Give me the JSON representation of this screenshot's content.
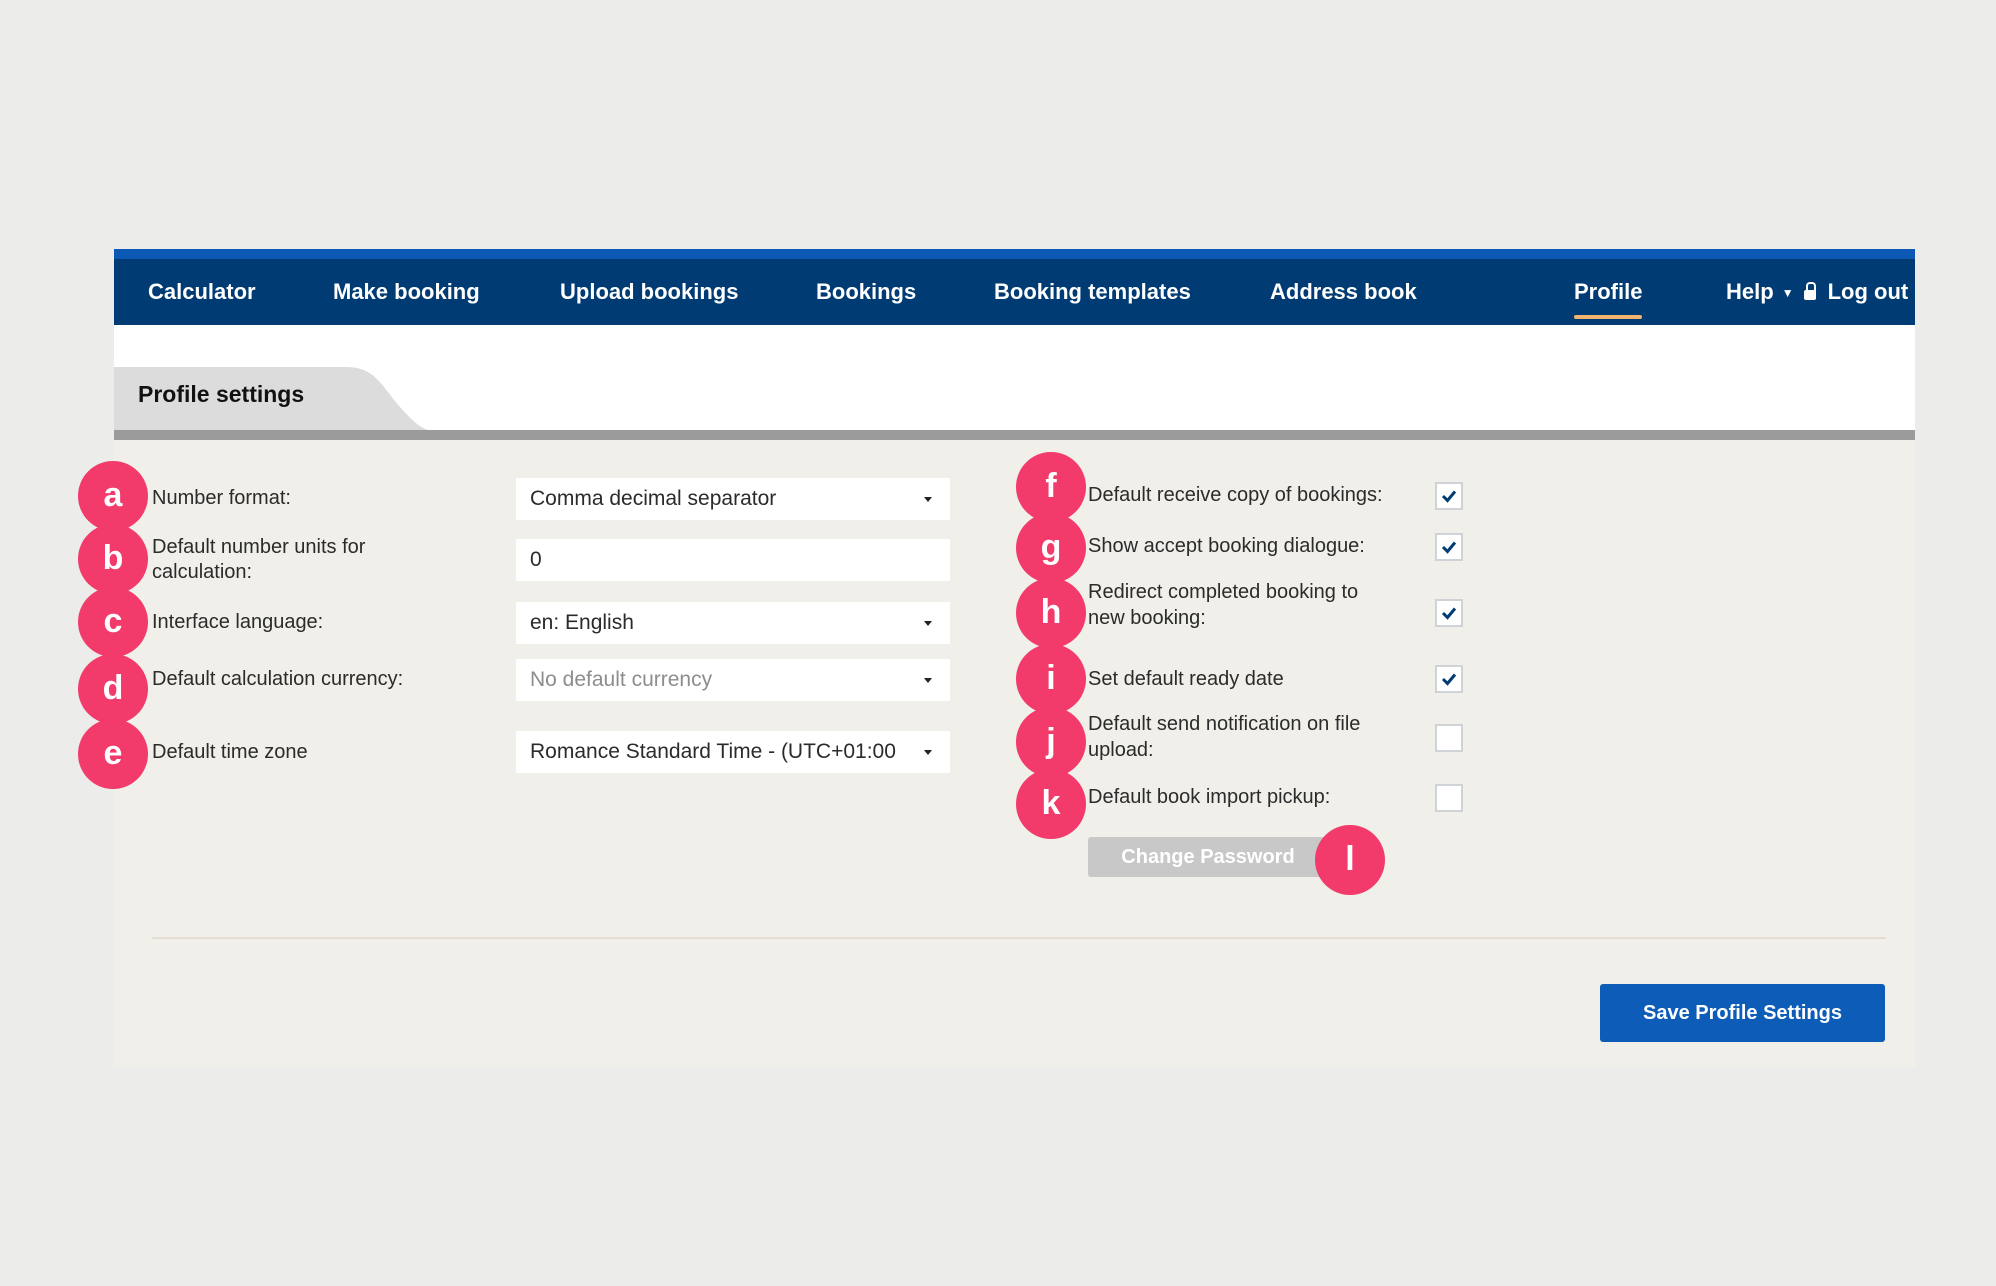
{
  "nav": {
    "items": [
      "Calculator",
      "Make booking",
      "Upload bookings",
      "Bookings",
      "Booking templates",
      "Address book",
      "Profile"
    ],
    "active": "Profile",
    "help": "Help",
    "logout": "Log out"
  },
  "tab": {
    "title": "Profile settings"
  },
  "left_form": {
    "number_format": {
      "label": "Number format:",
      "value": "Comma decimal separator",
      "badge": "a"
    },
    "default_units": {
      "label_line1": "Default number units for",
      "label_line2": "calculation:",
      "value": "0",
      "badge": "b"
    },
    "interface_language": {
      "label": "Interface language:",
      "value": "en: English",
      "badge": "c"
    },
    "calc_currency": {
      "label": "Default calculation currency:",
      "value": "No default currency",
      "badge": "d"
    },
    "time_zone": {
      "label": "Default time zone",
      "value": "Romance Standard Time - (UTC+01:00",
      "badge": "e"
    }
  },
  "right_form": {
    "receive_copy": {
      "label": "Default receive copy of bookings:",
      "checked": true,
      "badge": "f"
    },
    "accept_dialogue": {
      "label": "Show accept booking dialogue:",
      "checked": true,
      "badge": "g"
    },
    "redirect": {
      "label_line1": "Redirect completed booking to",
      "label_line2": "new booking:",
      "checked": true,
      "badge": "h"
    },
    "ready_date": {
      "label": "Set default ready date",
      "checked": true,
      "badge": "i"
    },
    "notification": {
      "label_line1": "Default send notification on file",
      "label_line2": "upload:",
      "checked": false,
      "badge": "j"
    },
    "import_pickup": {
      "label": "Default book import pickup:",
      "checked": false,
      "badge": "k"
    }
  },
  "change_password": {
    "label": "Change Password",
    "badge": "l"
  },
  "save_button": {
    "label": "Save Profile Settings"
  },
  "colors": {
    "nav_bg": "#003b73",
    "nav_top": "#0c58b5",
    "badge": "#f23a6b",
    "save_button": "#0d5db8",
    "active_underline": "#f2b46e"
  }
}
